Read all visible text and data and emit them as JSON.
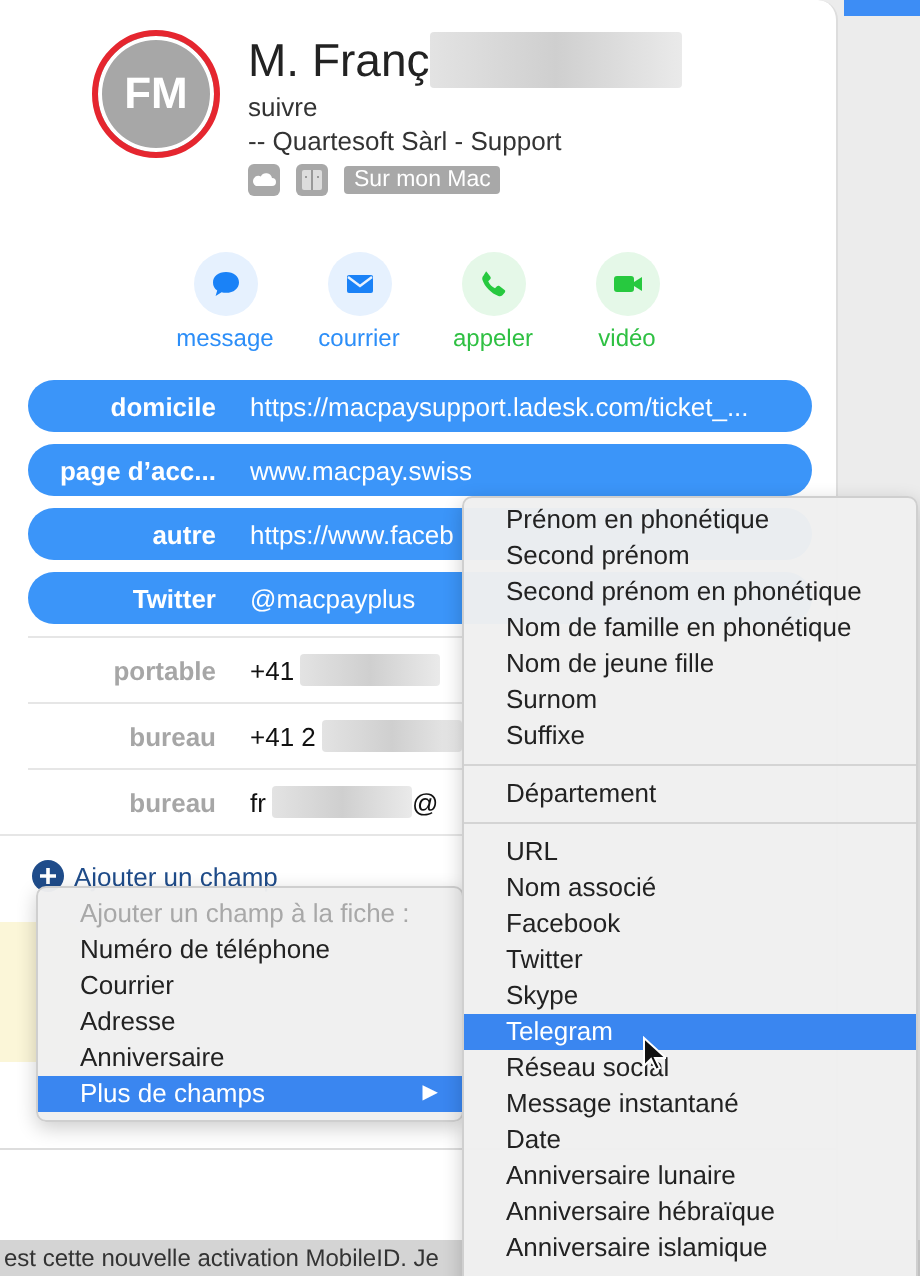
{
  "contact": {
    "initials": "FM",
    "name": "M. Franç",
    "name_redacted": true,
    "subtitle": "suivre",
    "company": "-- Quartesoft Sàrl - Support",
    "source_tag": "Sur mon Mac"
  },
  "actions": [
    {
      "label": "message",
      "kind": "message"
    },
    {
      "label": "courrier",
      "kind": "mail"
    },
    {
      "label": "appeler",
      "kind": "call"
    },
    {
      "label": "vidéo",
      "kind": "video"
    }
  ],
  "fields": [
    {
      "label": "domicile",
      "value": "https://macpaysupport.ladesk.com/ticket_...",
      "selected": true,
      "redacted": false
    },
    {
      "label": "page d’acc...",
      "value": "www.macpay.swiss",
      "selected": true,
      "redacted": false
    },
    {
      "label": "autre",
      "value": "https://www.faceb",
      "selected": true,
      "redacted": false
    },
    {
      "label": "Twitter",
      "value": "@macpayplus",
      "selected": true,
      "redacted": false
    },
    {
      "label": "portable",
      "value": "+41",
      "selected": false,
      "redacted": true
    },
    {
      "label": "bureau",
      "value": "+41 2",
      "selected": false,
      "redacted": true
    },
    {
      "label": "bureau",
      "value": "fr",
      "value_end": "@",
      "selected": false,
      "redacted": true
    }
  ],
  "add_field": {
    "label": "Ajouter un champ"
  },
  "add_menu": {
    "header": "Ajouter un champ à la fiche :",
    "items": [
      {
        "label": "Numéro de téléphone",
        "selected": false
      },
      {
        "label": "Courrier",
        "selected": false
      },
      {
        "label": "Adresse",
        "selected": false
      },
      {
        "label": "Anniversaire",
        "selected": false
      },
      {
        "label": "Plus de champs",
        "selected": true,
        "arrow": "▶"
      }
    ]
  },
  "more_menu": {
    "groups": [
      [
        {
          "label": "Prénom en phonétique",
          "selected": false
        },
        {
          "label": "Second prénom",
          "selected": false
        },
        {
          "label": "Second prénom en phonétique",
          "selected": false
        },
        {
          "label": "Nom de famille en phonétique",
          "selected": false
        },
        {
          "label": "Nom de jeune fille",
          "selected": false
        },
        {
          "label": "Surnom",
          "selected": false
        },
        {
          "label": "Suffixe",
          "selected": false
        }
      ],
      [
        {
          "label": "Département",
          "selected": false
        }
      ],
      [
        {
          "label": "URL",
          "selected": false
        },
        {
          "label": "Nom associé",
          "selected": false
        },
        {
          "label": "Facebook",
          "selected": false
        },
        {
          "label": "Twitter",
          "selected": false
        },
        {
          "label": "Skype",
          "selected": false
        },
        {
          "label": "Telegram",
          "selected": true
        },
        {
          "label": "Réseau social",
          "selected": false
        },
        {
          "label": "Message instantané",
          "selected": false
        },
        {
          "label": "Date",
          "selected": false
        },
        {
          "label": "Anniversaire lunaire",
          "selected": false
        },
        {
          "label": "Anniversaire hébraïque",
          "selected": false
        },
        {
          "label": "Anniversaire islamique",
          "selected": false
        }
      ]
    ]
  },
  "background_text": "est cette nouvelle activation MobileID. Je"
}
